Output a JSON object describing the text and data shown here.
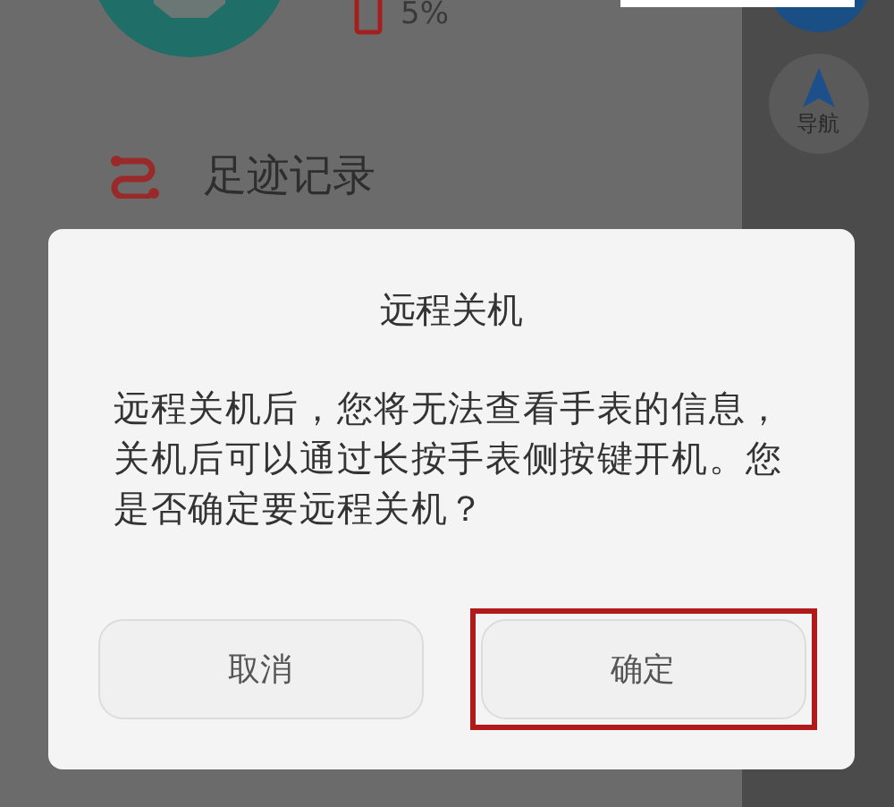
{
  "status": {
    "battery": "5%"
  },
  "menu": [
    {
      "label": "足迹记录"
    }
  ],
  "side_buttons": [
    {
      "label": "导航"
    }
  ],
  "dialog": {
    "title": "远程关机",
    "message": "远程关机后，您将无法查看手表的信息，关机后可以通过长按手表侧按键开机。您是否确定要远程关机？",
    "buttons": [
      {
        "label": "取消",
        "highlighted": false
      },
      {
        "label": "确定",
        "highlighted": true
      }
    ]
  }
}
